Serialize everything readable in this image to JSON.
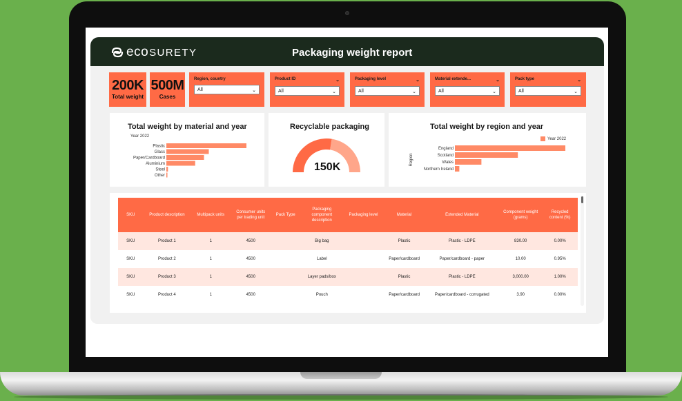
{
  "brand": {
    "eco": "eco",
    "surety": "SURETY"
  },
  "title": "Packaging weight report",
  "kpis": [
    {
      "value": "200K",
      "label": "Total weight"
    },
    {
      "value": "500M",
      "label": "Cases"
    }
  ],
  "filters": [
    {
      "label": "Region, country",
      "value": "All"
    },
    {
      "label": "Product ID",
      "value": "All"
    },
    {
      "label": "Packaging level",
      "value": "All"
    },
    {
      "label": "Material extende...",
      "value": "All"
    },
    {
      "label": "Pack type",
      "value": "All"
    }
  ],
  "material_chart": {
    "title": "Total weight by material and year",
    "legend": "Year 2022",
    "chart_data": {
      "type": "bar",
      "orientation": "horizontal",
      "categories": [
        "Plastic",
        "Glass",
        "Paper/Cardboard",
        "Aluminium",
        "Steel",
        "Other"
      ],
      "series": [
        {
          "name": "Year 2022",
          "values": [
            100,
            53,
            47,
            36,
            2,
            1
          ]
        }
      ]
    }
  },
  "gauge": {
    "title": "Recyclable packaging",
    "value": "150K",
    "fill_fraction": 0.55
  },
  "region_chart": {
    "title": "Total weight by region and year",
    "ylabel": "Region",
    "legend": "Year 2022",
    "chart_data": {
      "type": "bar",
      "orientation": "horizontal",
      "categories": [
        "England",
        "Scotland",
        "Wales",
        "Northern Ireland"
      ],
      "series": [
        {
          "name": "Year 2022",
          "values": [
            100,
            57,
            24,
            4
          ]
        }
      ]
    }
  },
  "table": {
    "headers": [
      "SKU",
      "Product description",
      "Multipack units",
      "Consumer units per trading unit",
      "Pack Type",
      "Packaging component description",
      "Packaging level",
      "Material",
      "Extended Material",
      "Component weight (grams)",
      "Recycled content (%)"
    ],
    "rows": [
      [
        "SKU",
        "Product 1",
        "1",
        "4500",
        "",
        "Big bag",
        "",
        "Plastic",
        "Plastic - LDPE",
        "830.00",
        "0.00%"
      ],
      [
        "SKU",
        "Product 2",
        "1",
        "4500",
        "",
        "Label",
        "",
        "Paper/cardboard",
        "Paper/cardboard - paper",
        "10.00",
        "0.95%"
      ],
      [
        "SKU",
        "Product 3",
        "1",
        "4500",
        "",
        "Layer pads/box",
        "",
        "Plastic",
        "Plastic - LDPE",
        "3,000.00",
        "1.00%"
      ],
      [
        "SKU",
        "Product 4",
        "1",
        "4500",
        "",
        "Pouch",
        "",
        "Paper/cardboard",
        "Paper/cardboard - corrugated",
        "3.90",
        "0.00%"
      ]
    ]
  },
  "colors": {
    "accent": "#ff6a45",
    "bar": "#ff8a66",
    "header_bg": "#1b2a1d",
    "row_alt": "#ffe7e0",
    "background": "#6ab04c"
  }
}
